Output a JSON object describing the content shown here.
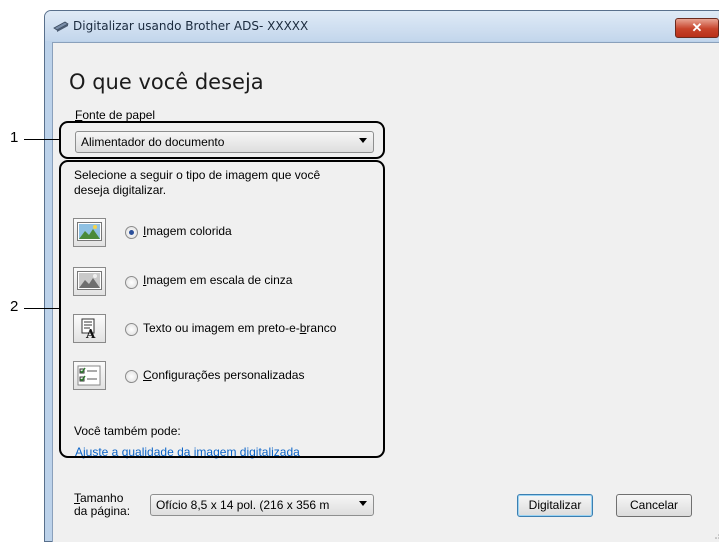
{
  "window": {
    "title": "Digitalizar usando Brother ADS- XXXXX",
    "close_symbol": "✕"
  },
  "heading": "O que você deseja",
  "paper_source": {
    "label_prefix": "F",
    "label_rest": "onte de papel",
    "value": "Alimentador do documento"
  },
  "image_type": {
    "instruction_line1": "Selecione a seguir o tipo de imagem que você",
    "instruction_line2": "deseja digitalizar.",
    "options": [
      {
        "label_prefix": "I",
        "label_rest": "magem colorida",
        "icon": "color-photo-icon",
        "checked": true
      },
      {
        "label_prefix": "",
        "label_mid": "I",
        "label_rest": "magem em escala de cinza",
        "icon": "grayscale-photo-icon",
        "checked": false
      },
      {
        "label_before": "Texto ou imagem em preto-e-",
        "label_u": "b",
        "label_after": "ranco",
        "icon": "text-image-icon",
        "checked": false
      },
      {
        "label_prefix": "C",
        "label_rest": "onfigurações personalizadas",
        "icon": "custom-settings-icon",
        "checked": false
      }
    ],
    "also_label": "Você também pode:",
    "quality_link": "Ajuste a qualidade da imagem digitalizada"
  },
  "page_size": {
    "label_u": "T",
    "label_line1_rest": "amanho",
    "label_line2": "da página:",
    "value": "Ofício 8,5 x 14 pol. (216 x 356 m"
  },
  "buttons": {
    "scan": "Digitalizar",
    "cancel": "Cancelar"
  },
  "callouts": {
    "one": "1",
    "two": "2"
  },
  "colors": {
    "link": "#0b64c8",
    "close": "#c7432a",
    "radio_dot": "#2a4f9a"
  }
}
